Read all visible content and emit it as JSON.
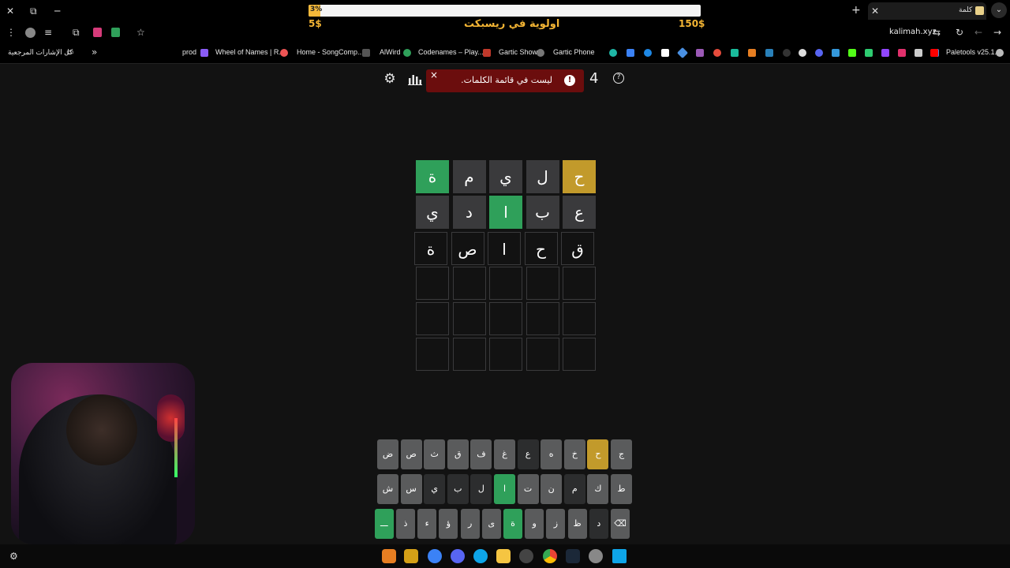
{
  "browser": {
    "tab_title": "كلمة",
    "url": "kalimah.xyz",
    "bookmarks_all_label": "كل الإشارات المرجعية",
    "bookmarks": [
      {
        "label": "prod"
      },
      {
        "label": "Wheel of Names | R..."
      },
      {
        "label": "Home - SongComp..."
      },
      {
        "label": "AlWird"
      },
      {
        "label": "Codenames – Play..."
      },
      {
        "label": "Gartic Show"
      },
      {
        "label": "Gartic Phone"
      },
      {
        "label": "Paletools v25.1.9"
      }
    ]
  },
  "overlay": {
    "progress_percent": 3,
    "progress_label": "3%",
    "left_amount": "5$",
    "right_amount": "150$",
    "center_title": "اولوية في ريسبكت"
  },
  "game": {
    "counter": "4",
    "toast": {
      "message": "ليست في قائمة الكلمات.",
      "close": "×",
      "alert": "!"
    },
    "board": [
      [
        {
          "l": "ح",
          "s": "present"
        },
        {
          "l": "ل",
          "s": "absent"
        },
        {
          "l": "ي",
          "s": "absent"
        },
        {
          "l": "م",
          "s": "absent"
        },
        {
          "l": "ة",
          "s": "correct"
        }
      ],
      [
        {
          "l": "ع",
          "s": "absent"
        },
        {
          "l": "ب",
          "s": "absent"
        },
        {
          "l": "ا",
          "s": "correct"
        },
        {
          "l": "د",
          "s": "absent"
        },
        {
          "l": "ي",
          "s": "absent"
        }
      ],
      [
        {
          "l": "ق",
          "s": "typed"
        },
        {
          "l": "ح",
          "s": "typed"
        },
        {
          "l": "ا",
          "s": "typed"
        },
        {
          "l": "ص",
          "s": "typed"
        },
        {
          "l": "ة",
          "s": "typed"
        }
      ],
      [
        {
          "l": "",
          "s": "empty"
        },
        {
          "l": "",
          "s": "empty"
        },
        {
          "l": "",
          "s": "empty"
        },
        {
          "l": "",
          "s": "empty"
        },
        {
          "l": "",
          "s": "empty"
        }
      ],
      [
        {
          "l": "",
          "s": "empty"
        },
        {
          "l": "",
          "s": "empty"
        },
        {
          "l": "",
          "s": "empty"
        },
        {
          "l": "",
          "s": "empty"
        },
        {
          "l": "",
          "s": "empty"
        }
      ],
      [
        {
          "l": "",
          "s": "empty"
        },
        {
          "l": "",
          "s": "empty"
        },
        {
          "l": "",
          "s": "empty"
        },
        {
          "l": "",
          "s": "empty"
        },
        {
          "l": "",
          "s": "empty"
        }
      ]
    ],
    "keyboard": [
      [
        {
          "k": "ج",
          "s": "key"
        },
        {
          "k": "ح",
          "s": "present"
        },
        {
          "k": "خ",
          "s": "key"
        },
        {
          "k": "ه",
          "s": "key"
        },
        {
          "k": "ع",
          "s": "absent"
        },
        {
          "k": "غ",
          "s": "key"
        },
        {
          "k": "ف",
          "s": "key"
        },
        {
          "k": "ق",
          "s": "key"
        },
        {
          "k": "ث",
          "s": "key"
        },
        {
          "k": "ص",
          "s": "key"
        },
        {
          "k": "ض",
          "s": "key"
        }
      ],
      [
        {
          "k": "ط",
          "s": "key"
        },
        {
          "k": "ك",
          "s": "key"
        },
        {
          "k": "م",
          "s": "absent"
        },
        {
          "k": "ن",
          "s": "key"
        },
        {
          "k": "ت",
          "s": "key"
        },
        {
          "k": "ا",
          "s": "correct"
        },
        {
          "k": "ل",
          "s": "absent"
        },
        {
          "k": "ب",
          "s": "absent"
        },
        {
          "k": "ي",
          "s": "absent"
        },
        {
          "k": "س",
          "s": "key"
        },
        {
          "k": "ش",
          "s": "key"
        }
      ],
      [
        {
          "k": "⌫",
          "s": "key"
        },
        {
          "k": "د",
          "s": "absent"
        },
        {
          "k": "ظ",
          "s": "key"
        },
        {
          "k": "ز",
          "s": "key"
        },
        {
          "k": "و",
          "s": "key"
        },
        {
          "k": "ة",
          "s": "correct"
        },
        {
          "k": "ى",
          "s": "key"
        },
        {
          "k": "ر",
          "s": "key"
        },
        {
          "k": "ؤ",
          "s": "key"
        },
        {
          "k": "ء",
          "s": "key"
        },
        {
          "k": "ذ",
          "s": "key"
        },
        {
          "k": "ـــ",
          "s": "correct"
        }
      ]
    ]
  },
  "colors": {
    "correct": "#2fa05a",
    "present": "#c29a2b",
    "absent": "#3a3a3c",
    "toast": "#6b0d0d"
  }
}
